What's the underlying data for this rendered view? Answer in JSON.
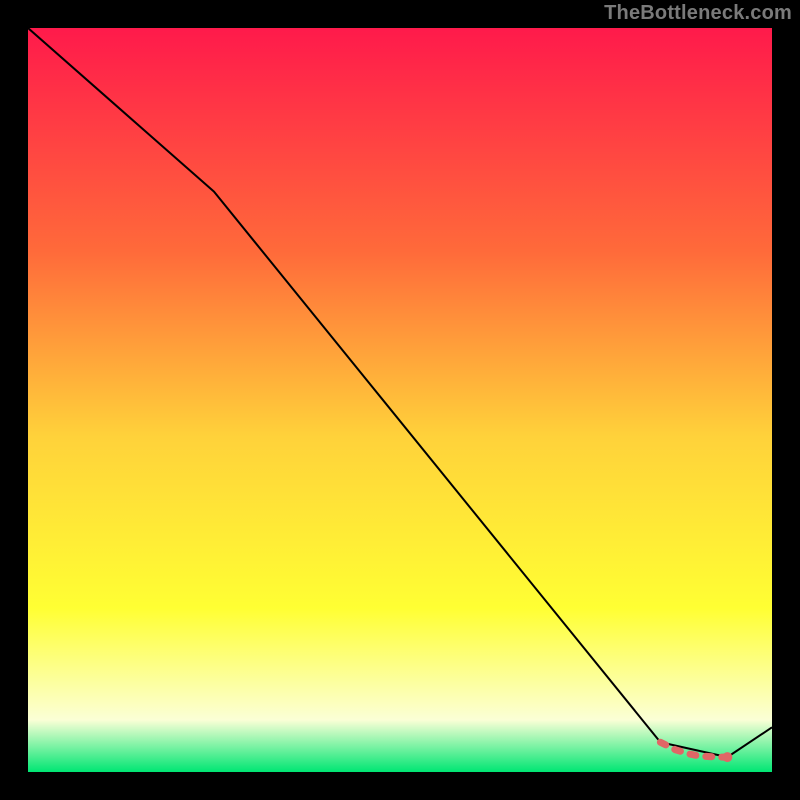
{
  "watermark": {
    "text": "TheBottleneck.com"
  },
  "colors": {
    "page_bg": "#000000",
    "gradient_top": "#ff1a4b",
    "gradient_mid_upper": "#ff6a3a",
    "gradient_mid": "#ffd23a",
    "gradient_mid_lower": "#ffff33",
    "gradient_pale": "#fbffd6",
    "gradient_bottom": "#00e673",
    "curve": "#000000",
    "dash": "#e06666"
  },
  "chart_data": {
    "type": "line",
    "title": "",
    "xlabel": "",
    "ylabel": "",
    "xlim": [
      0,
      100
    ],
    "ylim": [
      0,
      100
    ],
    "grid": false,
    "legend": false,
    "series": [
      {
        "name": "bottleneck-curve",
        "x": [
          0,
          25,
          85,
          94,
          100
        ],
        "values": [
          100,
          78,
          4,
          2,
          6
        ]
      },
      {
        "name": "sweet-spot-dash",
        "x": [
          85,
          86,
          87,
          88,
          89,
          90,
          91,
          92,
          93,
          94
        ],
        "values": [
          4,
          3.5,
          3,
          2.7,
          2.4,
          2.2,
          2.1,
          2.05,
          2,
          2
        ]
      }
    ]
  }
}
